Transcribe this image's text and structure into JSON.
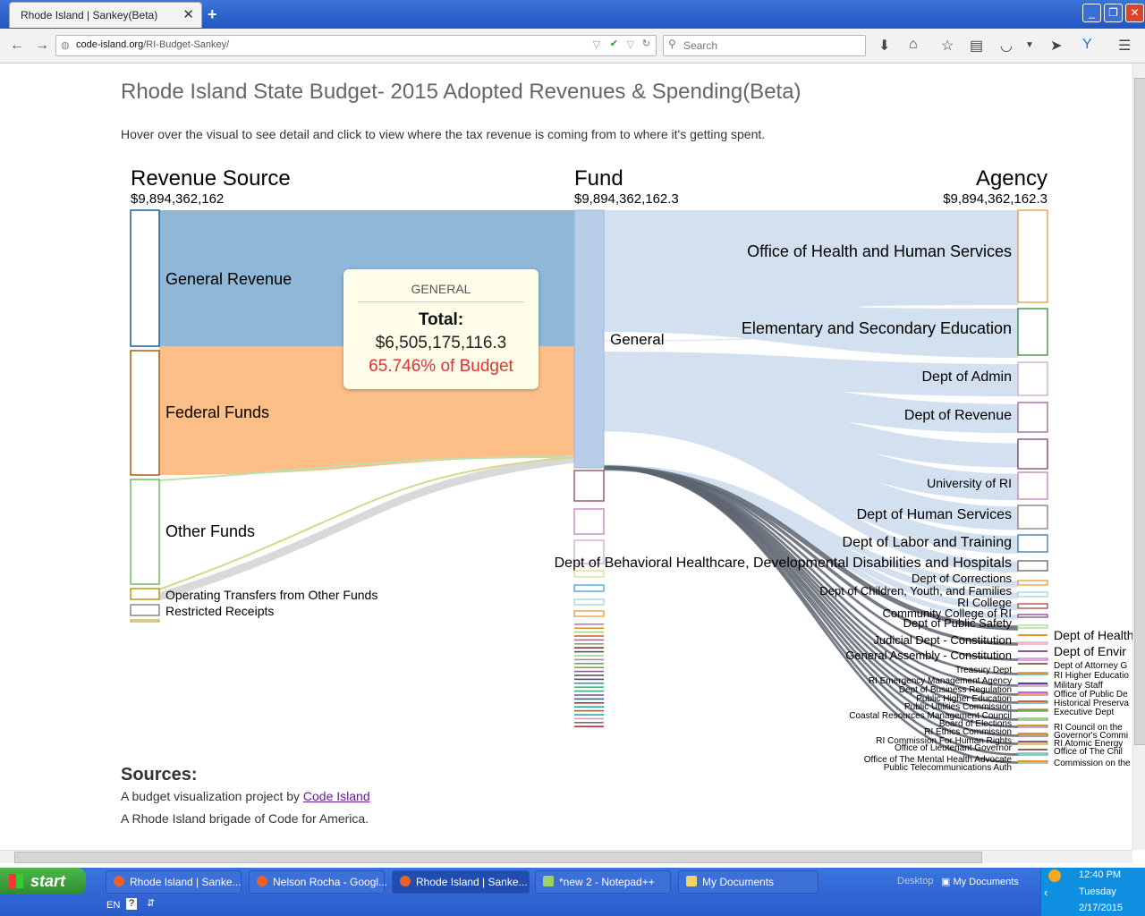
{
  "browser": {
    "tab_title": "Rhode Island | Sankey(Beta)",
    "url_host": "code-island.org",
    "url_path": "/RI-Budget-Sankey/",
    "search_placeholder": "Search"
  },
  "page": {
    "title": "Rhode Island State Budget- 2015 Adopted Revenues & Spending(Beta)",
    "subtitle": "Hover over the visual to see detail and click to view where the tax revenue is coming from to where it's getting spent."
  },
  "columns": {
    "revenue": {
      "title": "Revenue Source",
      "total": "$9,894,362,162"
    },
    "fund": {
      "title": "Fund",
      "total": "$9,894,362,162.3"
    },
    "agency": {
      "title": "Agency",
      "total": "$9,894,362,162.3"
    }
  },
  "chart_data": {
    "type": "sankey",
    "revenue_sources": [
      "General Revenue",
      "Federal Funds",
      "Other Funds",
      "Operating Transfers from Other Funds",
      "Restricted Receipts"
    ],
    "fund_labels": [
      "General"
    ],
    "agencies_left": [
      "Office of Health and Human Services",
      "Elementary and Secondary Education",
      "Dept of Admin",
      "Dept of Revenue",
      "University of RI",
      "Dept of Human Services",
      "Dept of Labor and Training",
      "Dept of Behavioral Healthcare, Developmental Disabilities and Hospitals",
      "Dept of Corrections",
      "Dept of Children, Youth, and Families",
      "RI College",
      "Community College of RI",
      "Dept of Public Safety",
      "Judicial Dept - Constitution",
      "General Assembly - Constitution",
      "Treasury Dept",
      "RI Emergency Management Agency",
      "Dept of Business Regulation",
      "Public Higher Education",
      "Public Utilities Commission",
      "Coastal Resources Management Council",
      "Board of Elections",
      "RI Ethics Commission",
      "RI Commission For Human Rights",
      "Office of Lieutenant Governor",
      "Office of The Mental Health Advocate",
      "Public Telecommunications Auth"
    ],
    "agencies_right": [
      "Dept of Health",
      "Dept of Envir",
      "Dept of Attorney G",
      "RI Higher Educatio",
      "Military Staff",
      "Office of Public De",
      "Historical Preserva",
      "Executive Dept",
      "RI Council on the",
      "Governor's Commi",
      "RI Atomic Energy",
      "Office of The Chil",
      "Commission on the"
    ]
  },
  "tooltip": {
    "heading": "GENERAL",
    "total_label": "Total:",
    "total_value": "$6,505,175,116.3",
    "percent": "65.746% of Budget"
  },
  "sources": {
    "heading": "Sources:",
    "line1_prefix": "A budget visualization project by ",
    "line1_link": "Code Island",
    "line2": "A Rhode Island brigade of Code for America."
  },
  "taskbar": {
    "start": "start",
    "items": [
      "Rhode Island | Sanke...",
      "Nelson Rocha - Googl...",
      "Rhode Island | Sanke...",
      "*new 2 - Notepad++",
      "My Documents"
    ],
    "desktop": "Desktop",
    "my_documents": "My Documents",
    "lang": "EN",
    "time": "12:40 PM",
    "day": "Tuesday",
    "date": "2/17/2015"
  },
  "colors": {
    "general_revenue": "#8fb8d8",
    "federal_funds": "#fdbf87",
    "fund_node": "#b8cde8",
    "agency_link": "#d3e0f0",
    "accent_red": "#d33333"
  }
}
